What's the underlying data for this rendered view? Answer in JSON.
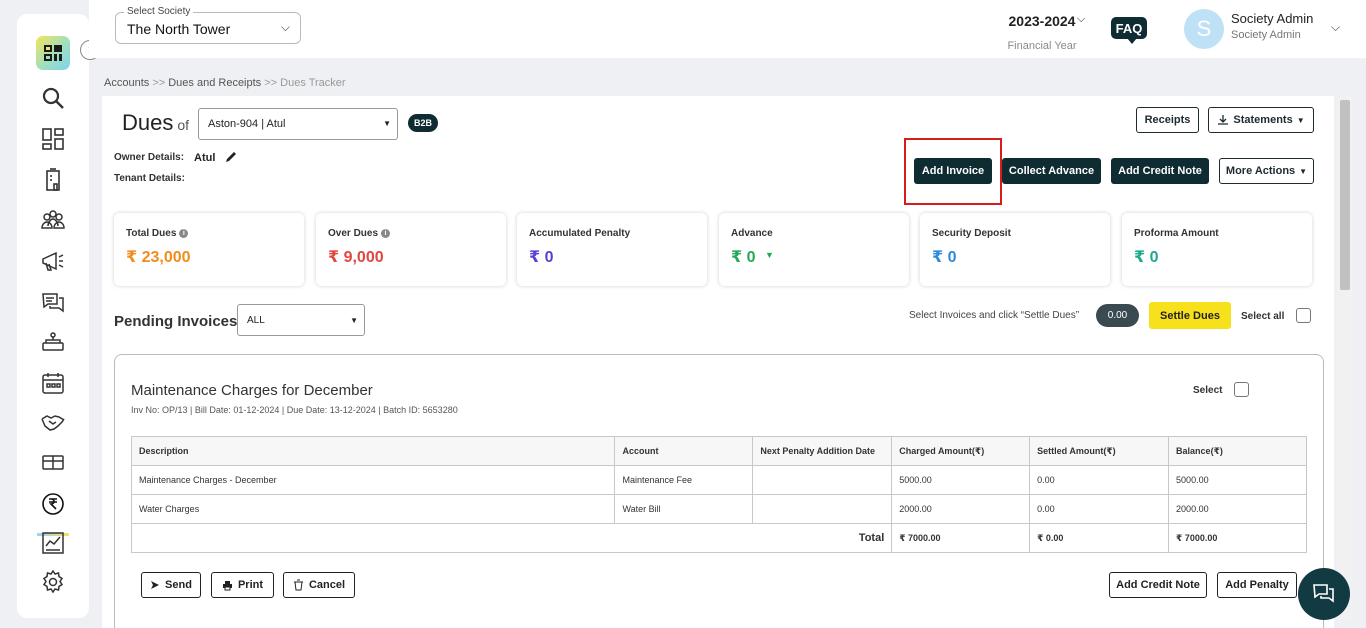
{
  "header": {
    "society_label": "Select Society",
    "society_value": "The North Tower",
    "financial_year": "2023-2024",
    "financial_year_label": "Financial Year",
    "faq": "FAQ",
    "avatar_initial": "S",
    "user_name": "Society Admin",
    "user_role": "Society Admin"
  },
  "breadcrumb": {
    "accounts": "Accounts",
    "sep": ">>",
    "dues_receipts": "Dues and Receipts",
    "current": "Dues Tracker"
  },
  "dues": {
    "title": "Dues",
    "of": "of",
    "unit_value": "Aston-904 | Atul",
    "badge": "B2B",
    "owner_label": "Owner Details:",
    "owner_value": "Atul",
    "tenant_label": "Tenant Details:"
  },
  "buttons": {
    "receipts": "Receipts",
    "statements": "Statements",
    "add_invoice": "Add Invoice",
    "collect_advance": "Collect Advance",
    "add_credit_note": "Add Credit Note",
    "more_actions": "More Actions"
  },
  "stats": [
    {
      "title": "Total Dues",
      "value": "₹ 23,000",
      "color": "#f28c1b",
      "info": true
    },
    {
      "title": "Over Dues",
      "value": "₹ 9,000",
      "color": "#e0483e",
      "info": true
    },
    {
      "title": "Accumulated Penalty",
      "value": "₹ 0",
      "color": "#5a3fd6"
    },
    {
      "title": "Advance",
      "value": "₹ 0",
      "color": "#26a65b"
    },
    {
      "title": "Security Deposit",
      "value": "₹ 0",
      "color": "#2a8ad8"
    },
    {
      "title": "Proforma Amount",
      "value": "₹ 0",
      "color": "#1ea88c"
    }
  ],
  "pending": {
    "title": "Pending Invoices",
    "filter": "ALL",
    "hint": "Select Invoices and click “Settle Dues”",
    "amount": "0.00",
    "settle": "Settle Dues",
    "select_all": "Select all"
  },
  "invoice": {
    "title": "Maintenance Charges for December",
    "meta": "Inv No: OP/13 | Bill Date: 01-12-2024 | Due Date: 13-12-2024 | Batch ID: 5653280",
    "select_label": "Select",
    "columns": [
      "Description",
      "Account",
      "Next Penalty Addition Date",
      "Charged Amount(₹)",
      "Settled Amount(₹)",
      "Balance(₹)"
    ],
    "rows": [
      [
        "Maintenance Charges - December",
        "Maintenance Fee",
        "",
        "5000.00",
        "0.00",
        "5000.00"
      ],
      [
        "Water Charges",
        "Water Bill",
        "",
        "2000.00",
        "0.00",
        "2000.00"
      ]
    ],
    "total_label": "Total",
    "total_charged": "₹ 7000.00",
    "total_settled": "₹ 0.00",
    "total_balance": "₹ 7000.00",
    "send": "Send",
    "print": "Print",
    "cancel": "Cancel",
    "add_credit_note": "Add Credit Note",
    "add_penalty": "Add Penalty"
  }
}
